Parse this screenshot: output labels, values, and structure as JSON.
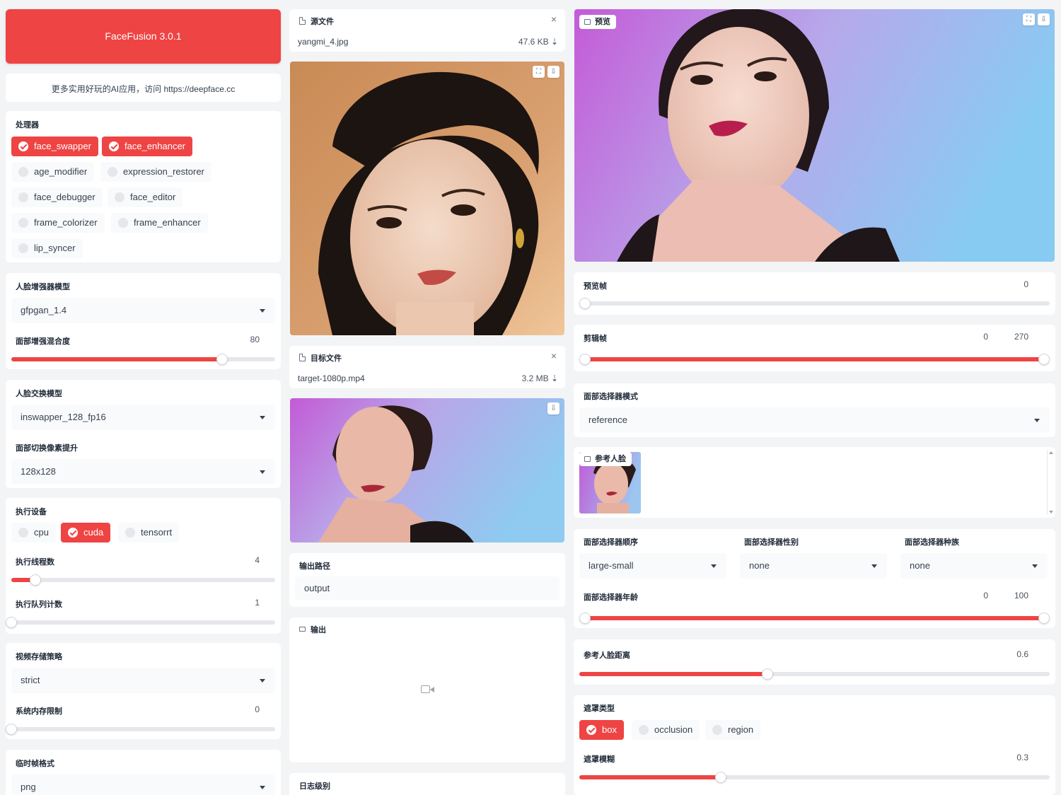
{
  "app": {
    "title": "FaceFusion 3.0.1",
    "banner": "更多实用好玩的AI应用，访问 https://deepface.cc"
  },
  "processors": {
    "label": "处理器",
    "items": [
      {
        "name": "face_swapper",
        "checked": true
      },
      {
        "name": "face_enhancer",
        "checked": true
      },
      {
        "name": "age_modifier",
        "checked": false
      },
      {
        "name": "expression_restorer",
        "checked": false
      },
      {
        "name": "face_debugger",
        "checked": false
      },
      {
        "name": "face_editor",
        "checked": false
      },
      {
        "name": "frame_colorizer",
        "checked": false
      },
      {
        "name": "frame_enhancer",
        "checked": false
      },
      {
        "name": "lip_syncer",
        "checked": false
      }
    ]
  },
  "face_enhancer": {
    "model_label": "人脸增强器模型",
    "model_value": "gfpgan_1.4",
    "blend_label": "面部增强混合度",
    "blend_value": "80",
    "blend_fraction": 0.8
  },
  "face_swapper": {
    "model_label": "人脸交换模型",
    "model_value": "inswapper_128_fp16",
    "pixel_boost_label": "面部切换像素提升",
    "pixel_boost_value": "128x128"
  },
  "execution": {
    "providers_label": "执行设备",
    "providers": [
      {
        "name": "cpu",
        "checked": false
      },
      {
        "name": "cuda",
        "checked": true
      },
      {
        "name": "tensorrt",
        "checked": false
      }
    ],
    "threads_label": "执行线程数",
    "threads_value": "4",
    "threads_fraction": 0.09,
    "queue_label": "执行队列计数",
    "queue_value": "1",
    "queue_fraction": 0.0
  },
  "memory": {
    "strategy_label": "视频存储策略",
    "strategy_value": "strict",
    "limit_label": "系统内存限制",
    "limit_value": "0",
    "limit_fraction": 0.0
  },
  "temp_frame": {
    "label": "临时帧格式",
    "value": "png"
  },
  "source": {
    "label": "源文件",
    "filename": "yangmi_4.jpg",
    "size": "47.6 KB ⇣",
    "close": "×"
  },
  "target": {
    "label": "目标文件",
    "filename": "target-1080p.mp4",
    "size": "3.2 MB ⇣",
    "close": "×"
  },
  "output_path": {
    "label": "输出路径",
    "value": "output"
  },
  "output": {
    "label": "输出"
  },
  "log_level": {
    "label": "日志级别"
  },
  "preview": {
    "label": "预览"
  },
  "preview_frame": {
    "label": "预览帧",
    "value": "0",
    "fraction": 0.0
  },
  "trim_frame": {
    "label": "剪辑帧",
    "start": "0",
    "end": "270",
    "start_fraction": 0.0,
    "end_fraction": 1.0
  },
  "face_selector": {
    "mode_label": "面部选择器模式",
    "mode_value": "reference",
    "reference_label": "参考人脸",
    "order_label": "面部选择器顺序",
    "order_value": "large-small",
    "gender_label": "面部选择器性别",
    "gender_value": "none",
    "race_label": "面部选择器种族",
    "race_value": "none",
    "age_label": "面部选择器年龄",
    "age_start": "0",
    "age_end": "100",
    "age_start_fraction": 0.0,
    "age_end_fraction": 1.0
  },
  "reference_distance": {
    "label": "参考人脸距离",
    "value": "0.6",
    "fraction": 0.4
  },
  "mask": {
    "types_label": "遮罩类型",
    "types": [
      {
        "name": "box",
        "checked": true
      },
      {
        "name": "occlusion",
        "checked": false
      },
      {
        "name": "region",
        "checked": false
      }
    ],
    "blur_label": "遮罩模糊",
    "blur_value": "0.3",
    "blur_fraction": 0.3
  },
  "colors": {
    "accent": "#ef4444",
    "panel": "#ffffff",
    "background": "#f3f4f6"
  },
  "icons": {
    "file": "file-icon",
    "image": "image-icon",
    "video": "video-camera-icon",
    "fullscreen": "fullscreen-icon",
    "download": "download-icon",
    "dropdown": "chevron-down-icon"
  }
}
